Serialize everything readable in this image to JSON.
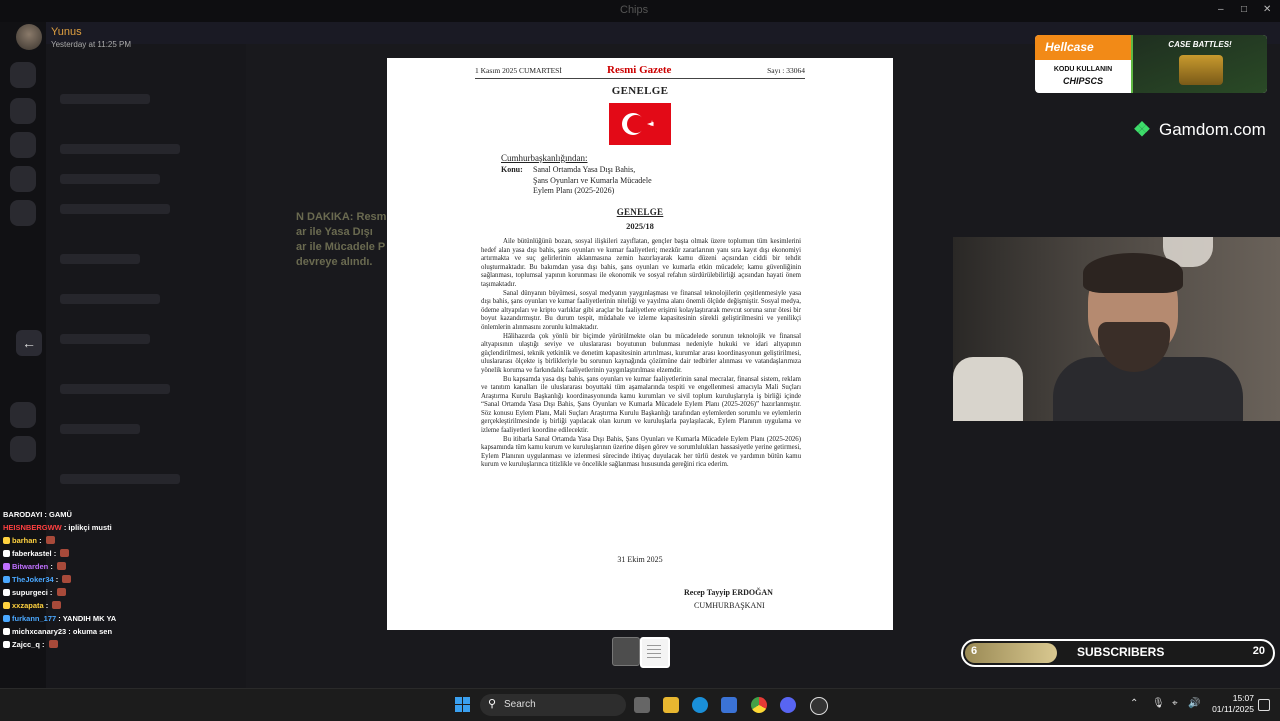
{
  "window": {
    "title": "Chips"
  },
  "header": {
    "user_name": "Yunus",
    "timestamp": "Yesterday at 11:25 PM"
  },
  "background_chat_snippet": [
    "N DAKIKA: Resmi G",
    "ar ile Yasa Dışı",
    "ar ile Mücadele P",
    "devreye alındı."
  ],
  "document": {
    "header_date": "1 Kasım 2025 CUMARTESİ",
    "header_title": "Resmi Gazete",
    "header_issue": "Sayı : 33064",
    "heading": "GENELGE",
    "from": "Cumhurbaşkanlığından:",
    "subject_label": "Konu:",
    "subject_lines": [
      "Sanal Ortamda Yasa Dışı Bahis,",
      "Şans Oyunları ve Kumarla Mücadele",
      "Eylem Planı (2025-2026)"
    ],
    "sub_heading": "GENELGE",
    "number": "2025/18",
    "paragraphs": [
      "Aile bütünlüğünü bozan, sosyal ilişkileri zayıflatan, gençler başta olmak üzere toplumun tüm kesimlerini hedef alan yasa dışı bahis, şans oyunları ve kumar faaliyetleri; mezkûr zararlarının yanı sıra kayıt dışı ekonomiyi artırmakta ve suç gelirlerinin aklanmasına zemin hazırlayarak kamu düzeni açısından ciddi bir tehdit oluşturmaktadır. Bu bakımdan yasa dışı bahis, şans oyunları ve kumarla etkin mücadele; kamu güvenliğinin sağlanması, toplumsal yapının korunması ile ekonomik ve sosyal refahın sürdürülebilirliği açısından hayati önem taşımaktadır.",
      "Sanal dünyanın büyümesi, sosyal medyanın yaygınlaşması ve finansal teknolojilerin çeşitlenmesiyle yasa dışı bahis, şans oyunları ve kumar faaliyetlerinin niteliği ve yayılma alanı önemli ölçüde değişmiştir. Sosyal medya, ödeme altyapıları ve kripto varlıklar gibi araçlar bu faaliyetlere erişimi kolaylaştırarak mevcut soruna sınır ötesi bir boyut kazandırmıştır. Bu durum tespit, müdahale ve izleme kapasitesinin sürekli geliştirilmesini ve yenilikçi önlemlerin alınmasını zorunlu kılmaktadır.",
      "Hâlihazırda çok yönlü bir biçimde yürütülmekte olan bu mücadelede sorunun teknolojik ve finansal altyapısının ulaştığı seviye ve uluslararası boyutunun bulunması nedeniyle hukuki ve idari altyapının güçlendirilmesi, teknik yetkinlik ve denetim kapasitesinin artırılması, kurumlar arası koordinasyonun geliştirilmesi, uluslararası ölçekte iş birlikleriyle bu sorunun kaynağında çözümüne dair tedbirler alınması ve vatandaşlarımıza yönelik koruma ve farkındalık faaliyetlerinin yaygınlaştırılması elzemdir.",
      "Bu kapsamda yasa dışı bahis, şans oyunları ve kumar faaliyetlerinin sanal mecralar, finansal sistem, reklam ve tanıtım kanalları ile uluslararası boyuttaki tüm aşamalarında tespiti ve engellenmesi amacıyla Mali Suçları Araştırma Kurulu Başkanlığı koordinasyonunda kamu kurumları ve sivil toplum kuruluşlarıyla iş birliği içinde “Sanal Ortamda Yasa Dışı Bahis, Şans Oyunları ve Kumarla Mücadele Eylem Planı (2025-2026)” hazırlanmıştır. Söz konusu Eylem Planı, Mali Suçları Araştırma Kurulu Başkanlığı tarafından eylemlerden sorumlu ve eylemlerin gerçekleştirilmesinde iş birliği yapılacak olan kurum ve kuruluşlarla paylaşılacak, Eylem Planının uygulama ve izleme faaliyetleri koordine edilecektir.",
      "Bu itibarla Sanal Ortamda Yasa Dışı Bahis, Şans Oyunları ve Kumarla Mücadele Eylem Planı (2025-2026) kapsamında tüm kamu kurum ve kuruluşlarının üzerine düşen görev ve sorumlulukları hassasiyetle yerine getirmesi, Eylem Planının uygulanması ve izlenmesi sürecinde ihtiyaç duyulacak her türlü destek ve yardımın bütün kamu kurum ve kuruluşlarınca titizlikle ve öncelikle sağlanması hususunda gereğini rica ederim."
    ],
    "date": "31 Ekim 2025",
    "signer_name": "Recep Tayyip ERDOĞAN",
    "signer_title": "CUMHURBAŞKANI"
  },
  "ads": {
    "hellcase_logo": "Hellcase",
    "hellcase_code_line1": "KODU KULLANIN",
    "hellcase_code_line2": "CHIPSCS",
    "hellcase_promo": "CASE BATTLES!",
    "gamdom": "Gamdom.com"
  },
  "subscribers": {
    "label": "SUBSCRIBERS",
    "current": "6",
    "goal": "20",
    "progress": 0.3
  },
  "chat": [
    {
      "user": "BARODAYI",
      "text": "GAMÜ",
      "color": "#ffffff"
    },
    {
      "user": "HEISNBERGWW",
      "text": "iplikçi musti",
      "color": "#ff4040"
    },
    {
      "user": "barhan",
      "text": "",
      "color": "#ffd23f"
    },
    {
      "user": "faberkastel",
      "text": "",
      "color": "#ffffff"
    },
    {
      "user": "Bitwarden",
      "text": "",
      "color": "#c070ff"
    },
    {
      "user": "TheJoker34",
      "text": "",
      "color": "#4aa8ff"
    },
    {
      "user": "supurgeci",
      "text": "",
      "color": "#ffffff"
    },
    {
      "user": "xxzapata",
      "text": "",
      "color": "#ffd23f"
    },
    {
      "user": "furkann_177",
      "text": "YANDIH MK YA",
      "color": "#4aa8ff"
    },
    {
      "user": "michxcanary23",
      "text": "okuma sen",
      "color": "#ffffff"
    },
    {
      "user": "Zajcc_q",
      "text": "",
      "color": "#ffffff"
    }
  ],
  "taskbar": {
    "search_label": "Search",
    "time": "15:07",
    "date": "01/11/2025"
  }
}
